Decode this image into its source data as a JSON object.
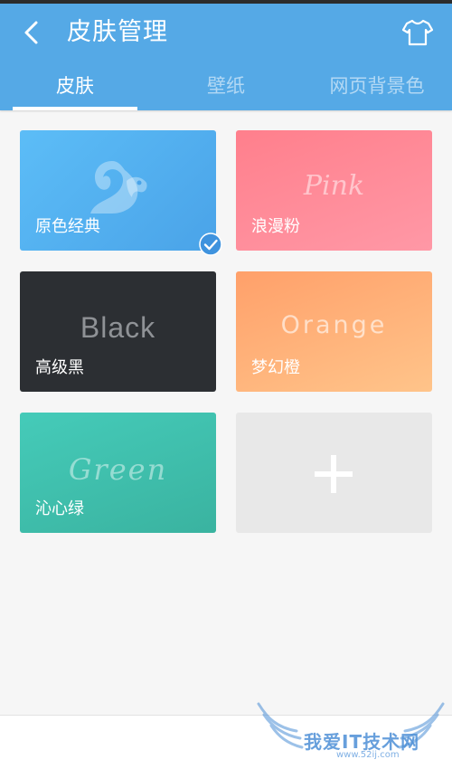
{
  "header": {
    "title": "皮肤管理",
    "back_icon": "back-arrow-icon",
    "shirt_icon": "tshirt-icon",
    "color": "#55a9e6"
  },
  "tabs": [
    {
      "label": "皮肤",
      "active": true
    },
    {
      "label": "壁纸",
      "active": false
    },
    {
      "label": "网页背景色",
      "active": false
    }
  ],
  "skins": [
    {
      "name": "原色经典",
      "word": "",
      "selected": true,
      "color": "#4fb0f0"
    },
    {
      "name": "浪漫粉",
      "word": "Pink",
      "selected": false,
      "color": "#ff8c99"
    },
    {
      "name": "高级黑",
      "word": "Black",
      "selected": false,
      "color": "#2c2f33"
    },
    {
      "name": "梦幻橙",
      "word": "Orange",
      "selected": false,
      "color": "#ffb078"
    },
    {
      "name": "沁心绿",
      "word": "Green",
      "selected": false,
      "color": "#40bfad"
    }
  ],
  "add_card": {
    "icon": "plus-icon"
  },
  "watermark": {
    "text": "我爱IT技术网",
    "url": "www.52ij.com"
  }
}
